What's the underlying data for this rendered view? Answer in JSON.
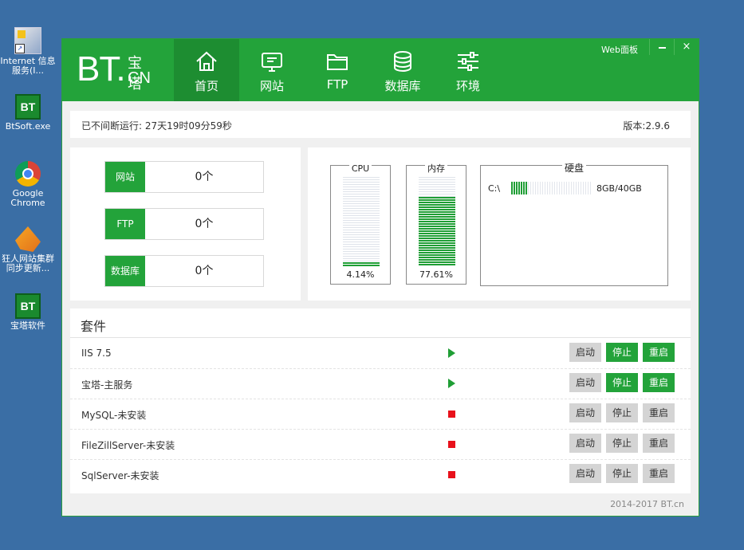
{
  "desktop": {
    "icons": [
      {
        "label": "Internet 信息服务(I...",
        "icon": "iis-icon"
      },
      {
        "label": "BtSoft.exe",
        "icon": "bt-icon"
      },
      {
        "label": "Google Chrome",
        "icon": "chrome-icon"
      },
      {
        "label": "狂人网站集群同步更新...",
        "icon": "spider-icon"
      },
      {
        "label": "宝塔软件",
        "icon": "bt-icon"
      }
    ]
  },
  "window": {
    "logo": {
      "bt": "BT.",
      "cn_top": "宝塔",
      "cn_bottom": "CN"
    },
    "nav": [
      {
        "label": "首页",
        "icon": "home-icon",
        "active": true
      },
      {
        "label": "网站",
        "icon": "monitor-icon"
      },
      {
        "label": "FTP",
        "icon": "folder-icon"
      },
      {
        "label": "数据库",
        "icon": "database-icon"
      },
      {
        "label": "环境",
        "icon": "sliders-icon"
      }
    ],
    "web_panel": "Web面板",
    "minimize": "–",
    "close": "×"
  },
  "uptime": {
    "label": "已不间断运行: 27天19时09分59秒",
    "version": "版本:2.9.6"
  },
  "counts": [
    {
      "label": "网站",
      "value": "0个"
    },
    {
      "label": "FTP",
      "value": "0个"
    },
    {
      "label": "数据库",
      "value": "0个"
    }
  ],
  "resources": {
    "cpu": {
      "title": "CPU",
      "value": "4.14%",
      "percent": 4.14
    },
    "memory": {
      "title": "内存",
      "value": "77.61%",
      "percent": 77.61
    },
    "disk": {
      "title": "硬盘",
      "drive": "C:\\",
      "value": "8GB/40GB",
      "percent": 20
    }
  },
  "services": {
    "title": "套件",
    "buttons": {
      "start": "启动",
      "stop": "停止",
      "restart": "重启"
    },
    "rows": [
      {
        "name": "IIS 7.5",
        "status": "running"
      },
      {
        "name": "宝塔-主服务",
        "status": "running"
      },
      {
        "name": "MySQL-未安装",
        "status": "stopped"
      },
      {
        "name": "FileZillServer-未安装",
        "status": "stopped"
      },
      {
        "name": "SqlServer-未安装",
        "status": "stopped"
      }
    ]
  },
  "footer": {
    "copyright": "2014-2017 BT.cn"
  },
  "colors": {
    "brand_green": "#23a33a",
    "stop_red": "#e8111b",
    "desktop_blue": "#3a6ea5"
  }
}
